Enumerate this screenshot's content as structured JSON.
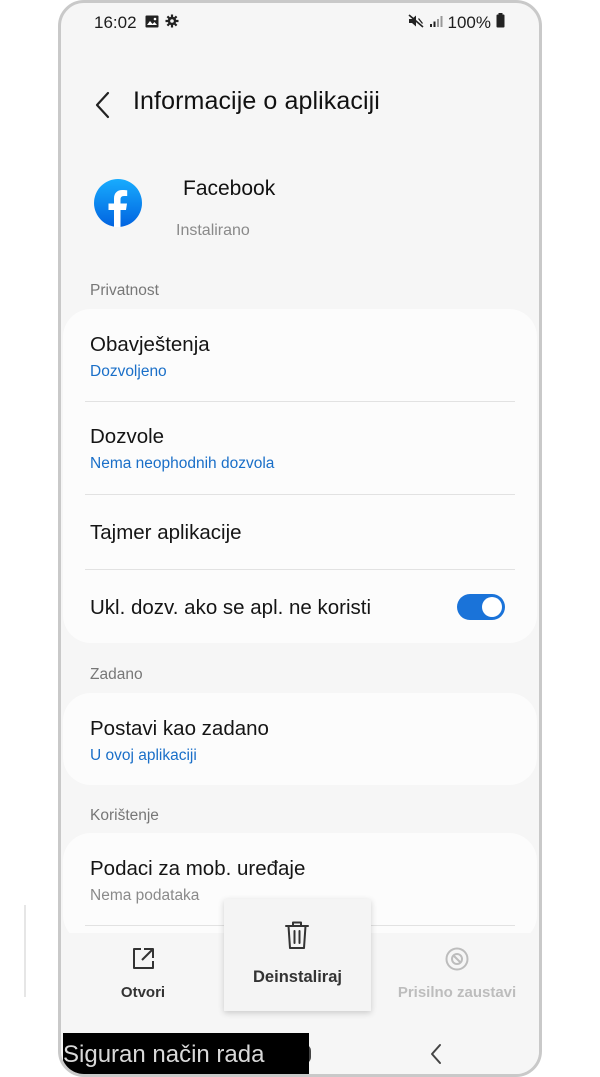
{
  "status_bar": {
    "time": "16:02",
    "battery": "100%"
  },
  "header": {
    "title": "Informacije o aplikaciji"
  },
  "app": {
    "name": "Facebook",
    "status": "Instalirano",
    "icon": "facebook-logo",
    "brand_color": "#1877f2"
  },
  "sections": {
    "privacy": {
      "label": "Privatnost",
      "notifications": {
        "title": "Obavještenja",
        "value": "Dozvoljeno"
      },
      "permissions": {
        "title": "Dozvole",
        "value": "Nema neophodnih dozvola"
      },
      "app_timer": {
        "title": "Tajmer aplikacije"
      },
      "remove_permissions": {
        "title": "Ukl. dozv. ako se apl. ne koristi",
        "enabled": true
      }
    },
    "defaults": {
      "label": "Zadano",
      "set_default": {
        "title": "Postavi kao zadano",
        "value": "U ovoj aplikaciji"
      }
    },
    "usage": {
      "label": "Korištenje",
      "mobile_data": {
        "title": "Podaci za mob. uređaje",
        "value": "Nema podataka"
      }
    }
  },
  "actions": {
    "open": "Otvori",
    "uninstall": "Deinstaliraj",
    "force_stop": "Prisilno zaustavi"
  },
  "safe_mode": {
    "text": "Siguran način rada"
  },
  "colors": {
    "accent": "#1a73d9",
    "link": "#1a6fc8",
    "background": "#f6f6f6"
  }
}
